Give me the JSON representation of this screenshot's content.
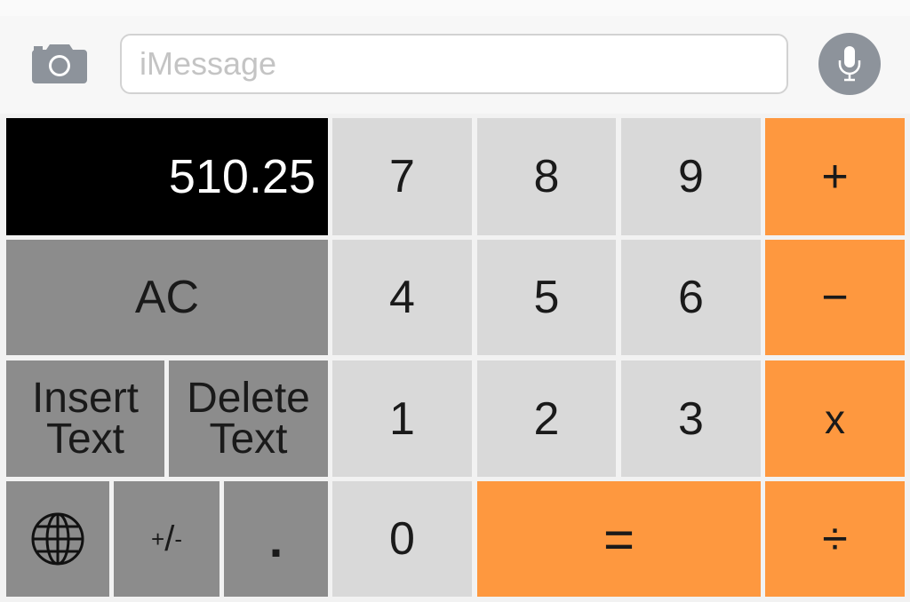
{
  "message_bar": {
    "placeholder": "iMessage",
    "camera_icon": "camera-icon",
    "mic_icon": "microphone-icon"
  },
  "calculator": {
    "display": "510.25",
    "keys": {
      "seven": "7",
      "eight": "8",
      "nine": "9",
      "four": "4",
      "five": "5",
      "six": "6",
      "one": "1",
      "two": "2",
      "three": "3",
      "zero": "0",
      "plus": "+",
      "minus": "−",
      "times": "x",
      "divide": "÷",
      "equals": "=",
      "clear": "AC",
      "insert_text_line1": "Insert",
      "insert_text_line2": "Text",
      "delete_text_line1": "Delete",
      "delete_text_line2": "Text",
      "plus_minus_plus": "+",
      "plus_minus_slash": "/",
      "plus_minus_minus": "-",
      "decimal": ".",
      "globe_icon": "globe-icon"
    },
    "colors": {
      "number_key": "#d9d9d9",
      "operator_key": "#fe983f",
      "function_key": "#8c8c8c",
      "display_bg": "#000000"
    }
  }
}
